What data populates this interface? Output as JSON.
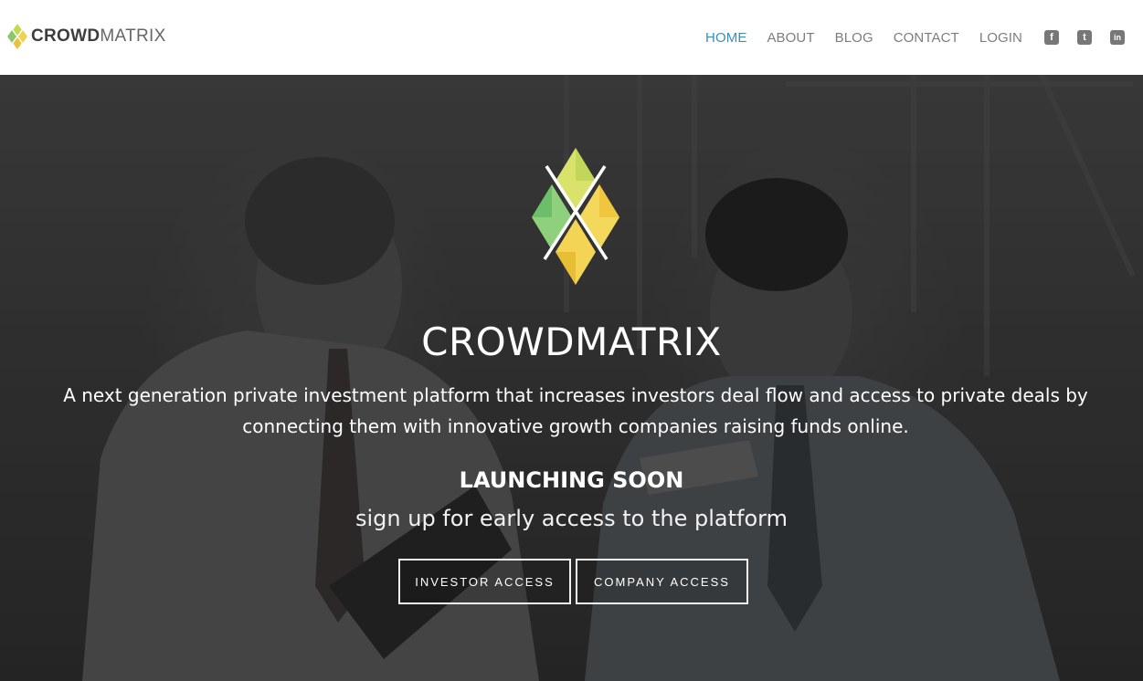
{
  "brand": {
    "name_bold": "CROWD",
    "name_light": "MATRIX",
    "accent": "#3a8fb7",
    "logo_colors": [
      "#c5d94f",
      "#8cc86b",
      "#f2d24a",
      "#e8c23a"
    ]
  },
  "nav": {
    "items": [
      {
        "label": "HOME",
        "active": true
      },
      {
        "label": "ABOUT",
        "active": false
      },
      {
        "label": "BLOG",
        "active": false
      },
      {
        "label": "CONTACT",
        "active": false
      },
      {
        "label": "LOGIN",
        "active": false
      }
    ],
    "social": [
      {
        "icon": "facebook-icon",
        "glyph": "f"
      },
      {
        "icon": "twitter-icon",
        "glyph": "t"
      },
      {
        "icon": "linkedin-icon",
        "glyph": "in"
      }
    ]
  },
  "hero": {
    "title": "CROWDMATRIX",
    "description": "A next generation private investment platform that increases investors deal flow and access to private deals by connecting them with innovative growth companies raising funds online.",
    "launch": "LAUNCHING SOON",
    "subtitle": "sign up for early access to the platform",
    "buttons": {
      "investor": "INVESTOR ACCESS",
      "company": "COMPANY ACCESS"
    }
  }
}
